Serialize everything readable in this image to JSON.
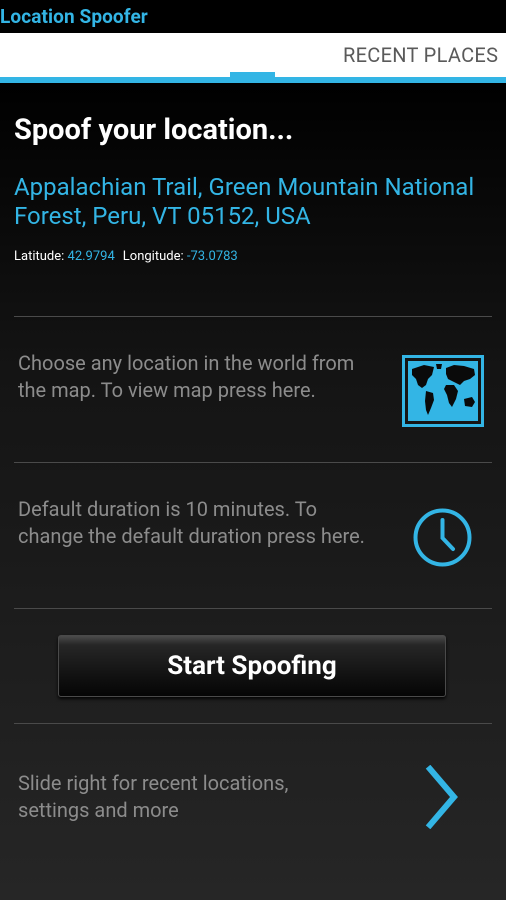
{
  "app": {
    "title": "Location Spoofer"
  },
  "tabs": {
    "label": "RECENT PLACES"
  },
  "main": {
    "heading": "Spoof your location...",
    "address": "Appalachian Trail, Green Mountain National Forest, Peru, VT 05152, USA",
    "latitude_label": "Latitude:",
    "latitude_value": "42.9794",
    "longitude_label": "Longitude:",
    "longitude_value": "-73.0783",
    "map_text": "Choose any location in the world from the map. To view map press here.",
    "map_icon": "world-map-icon",
    "duration_text": "Default duration is 10 minutes. To change the default duration press here.",
    "duration_icon": "clock-icon",
    "start_button": "Start Spoofing",
    "slide_text": "Slide right for recent locations, settings and more",
    "slide_icon": "chevron-right-icon"
  },
  "colors": {
    "accent": "#33b5e5",
    "muted_text": "#8c8c8c",
    "background": "#000000"
  }
}
